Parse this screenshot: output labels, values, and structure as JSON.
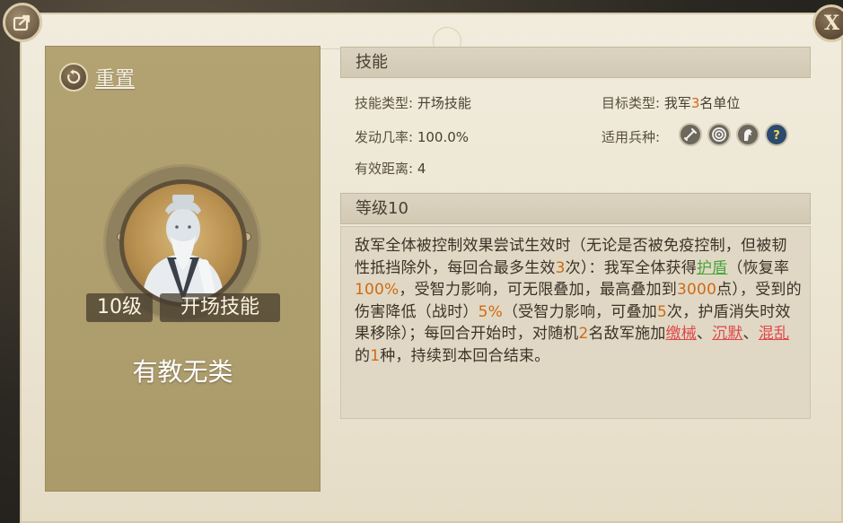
{
  "colors": {
    "accent_orange": "#d06a12",
    "accent_green": "#4aa43a",
    "accent_red": "#e0484a",
    "card_bg": "#b3a373",
    "panel_bg": "#ebe4d1"
  },
  "top_bar": {
    "share_icon": "share-icon",
    "close_label": "X"
  },
  "left_card": {
    "reset_label": "重置",
    "reset_icon": "reset-icon",
    "portrait_icon": "sage-portrait",
    "level_badge": "10级",
    "type_badge": "开场技能",
    "skill_name": "有教无类"
  },
  "skill_section": {
    "title": "技能",
    "type_label": "技能类型:",
    "type_value": "开场技能",
    "target_label": "目标类型:",
    "target_pre": "我军",
    "target_num": "3",
    "target_post": "名单位",
    "chance_label": "发动几率:",
    "chance_value": "100.0%",
    "troop_label": "适用兵种:",
    "troops": [
      "sword-icon",
      "target-icon",
      "horse-icon",
      "question-icon"
    ],
    "range_label": "有效距离:",
    "range_value": "4"
  },
  "level_section": {
    "title": "等级10",
    "desc": [
      {
        "t": "敌军全体被控制效果尝试生效时（无论是否被免疫控制，但被韧性抵挡除外，每回合最多生效",
        "s": ""
      },
      {
        "t": "3",
        "s": "orange"
      },
      {
        "t": "次）：我军全体获得",
        "s": ""
      },
      {
        "t": "护盾",
        "s": "green"
      },
      {
        "t": "（恢复率",
        "s": ""
      },
      {
        "t": "100%",
        "s": "orange"
      },
      {
        "t": "，受智力影响，可无限叠加，最高叠加到",
        "s": ""
      },
      {
        "t": "3000",
        "s": "orange"
      },
      {
        "t": "点），受到的伤害降低（战时）",
        "s": ""
      },
      {
        "t": "5%",
        "s": "orange"
      },
      {
        "t": "（受智力影响，可叠加",
        "s": ""
      },
      {
        "t": "5",
        "s": "orange"
      },
      {
        "t": "次，护盾消失时效果移除）；每回合开始时，对随机",
        "s": ""
      },
      {
        "t": "2",
        "s": "orange"
      },
      {
        "t": "名敌军施加",
        "s": ""
      },
      {
        "t": "缴械",
        "s": "red"
      },
      {
        "t": "、",
        "s": ""
      },
      {
        "t": "沉默",
        "s": "red"
      },
      {
        "t": "、",
        "s": ""
      },
      {
        "t": "混乱",
        "s": "red"
      },
      {
        "t": "的",
        "s": ""
      },
      {
        "t": "1",
        "s": "orange"
      },
      {
        "t": "种，持续到本回合结束。",
        "s": ""
      }
    ]
  }
}
